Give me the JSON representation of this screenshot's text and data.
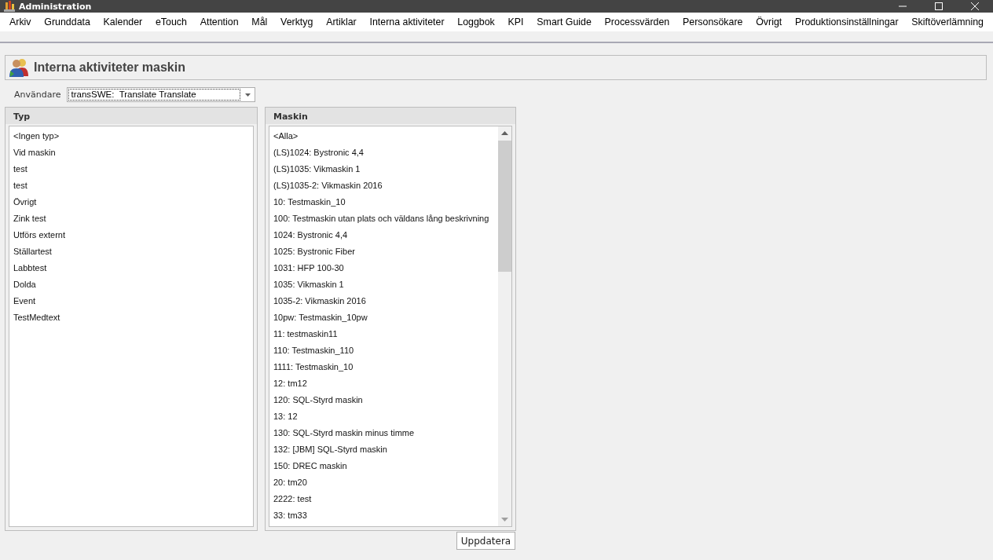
{
  "window": {
    "title": "Administration"
  },
  "menu": [
    "Arkiv",
    "Grunddata",
    "Kalender",
    "eTouch",
    "Attention",
    "Mål",
    "Verktyg",
    "Artiklar",
    "Interna aktiviteter",
    "Loggbok",
    "KPI",
    "Smart Guide",
    "Processvärden",
    "Personsökare",
    "Övrigt",
    "Produktionsinställningar",
    "Skiftöverlämning"
  ],
  "page": {
    "title": "Interna aktiviteter maskin"
  },
  "user_field": {
    "label": "Användare",
    "value": "transSWE:  Translate Translate"
  },
  "panels": [
    {
      "title": "Typ",
      "items": [
        "<Ingen typ>",
        "Vid maskin",
        "test",
        "test",
        "Övrigt",
        "Zink test",
        "Utförs externt",
        "Ställartest",
        "Labbtest",
        "Dolda",
        "Event",
        "TestMedtext"
      ]
    },
    {
      "title": "Maskin",
      "items": [
        "<Alla>",
        "(LS)1024: Bystronic 4,4",
        "(LS)1035: Vikmaskin 1",
        "(LS)1035-2: Vikmaskin 2016",
        "10: Testmaskin_10",
        "100: Testmaskin utan plats och väldans lång beskrivning",
        "1024: Bystronic 4,4",
        "1025: Bystronic Fiber",
        "1031: HFP 100-30",
        "1035: Vikmaskin 1",
        "1035-2: Vikmaskin 2016",
        "10pw: Testmaskin_10pw",
        "11: testmaskin11",
        "110: Testmaskin_110",
        "1111: Testmaskin_10",
        "12: tm12",
        "120: SQL-Styrd maskin",
        "13: 12",
        "130: SQL-Styrd maskin minus timme",
        "132: [JBM] SQL-Styrd maskin",
        "150: DREC maskin",
        "20: tm20",
        "2222: test",
        "33: tm33"
      ]
    }
  ],
  "buttons": [
    "Uppdatera"
  ]
}
